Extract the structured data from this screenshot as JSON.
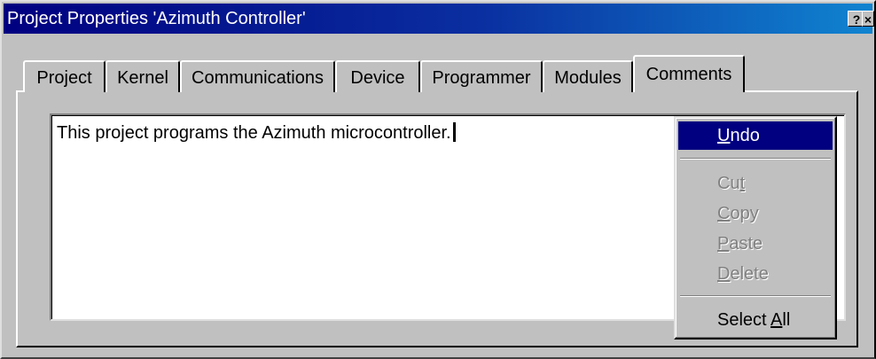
{
  "window": {
    "title": "Project Properties 'Azimuth Controller'",
    "help_glyph": "?",
    "close_glyph": "×"
  },
  "tabs": [
    {
      "label": "Project",
      "active": false
    },
    {
      "label": "Kernel",
      "active": false
    },
    {
      "label": "Communications",
      "active": false
    },
    {
      "label": "Device",
      "active": false
    },
    {
      "label": "Programmer",
      "active": false
    },
    {
      "label": "Modules",
      "active": false
    },
    {
      "label": "Comments",
      "active": true
    }
  ],
  "comments": {
    "text": "This project programs the Azimuth microcontroller."
  },
  "context_menu": {
    "undo": {
      "pre": "",
      "key": "U",
      "post": "ndo",
      "state": "highlighted"
    },
    "cut": {
      "pre": "Cu",
      "key": "t",
      "post": "",
      "state": "disabled"
    },
    "copy": {
      "pre": "",
      "key": "C",
      "post": "opy",
      "state": "disabled"
    },
    "paste": {
      "pre": "",
      "key": "P",
      "post": "aste",
      "state": "disabled"
    },
    "delete": {
      "pre": "",
      "key": "D",
      "post": "elete",
      "state": "disabled"
    },
    "select_all": {
      "pre": "Select ",
      "key": "A",
      "post": "ll",
      "state": "enabled"
    }
  },
  "colors": {
    "title_bar_start": "#000080",
    "title_bar_end": "#1084d0",
    "dialog_face": "#c0c0c0",
    "menu_highlight": "#000080"
  }
}
